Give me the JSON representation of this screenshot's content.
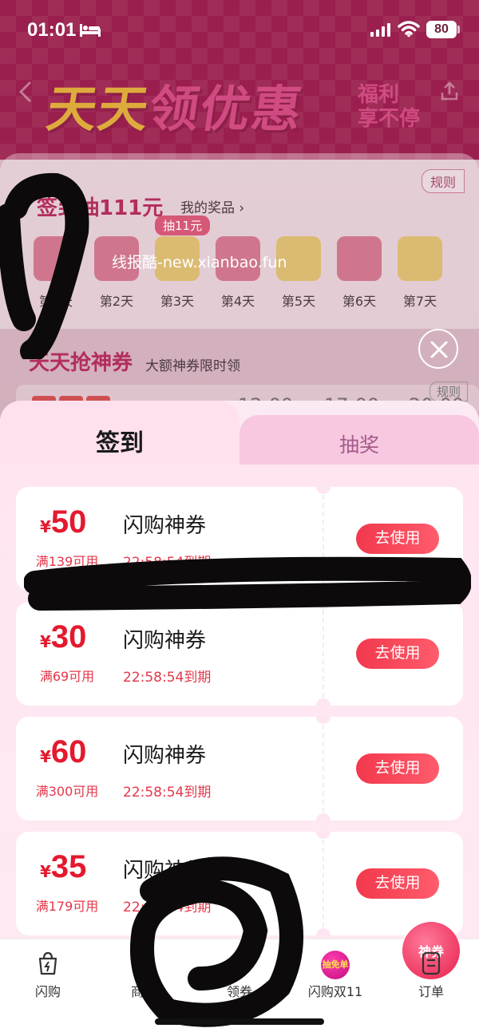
{
  "status_bar": {
    "time": "01:01",
    "battery": "80"
  },
  "banner": {
    "title_part1": "天天",
    "title_part2": "领优惠",
    "sub_line1": "福利",
    "sub_line2": "享不停"
  },
  "signin_section": {
    "rules": "规则",
    "title": "签到抽111元",
    "my_prizes": "我的奖品 ›",
    "lottery_bubble": "抽11元",
    "days": [
      "第1天",
      "第2天",
      "第3天",
      "第4天",
      "第5天",
      "第6天",
      "第7天"
    ]
  },
  "grab_section": {
    "title": "天天抢神券",
    "subtitle": "大额神券限时领",
    "rules": "规则",
    "slots": [
      "12:00",
      "17:00",
      "20:00"
    ]
  },
  "watermark": "线报酷-new.xianbao.fun",
  "modal": {
    "tabs": {
      "active": "签到",
      "inactive": "抽奖"
    },
    "coupons": [
      {
        "currency": "¥",
        "amount": "50",
        "condition": "满139可用",
        "name": "闪购神券",
        "expiry": "22:58:54到期",
        "action": "去使用"
      },
      {
        "currency": "¥",
        "amount": "30",
        "condition": "满69可用",
        "name": "闪购神券",
        "expiry": "22:58:54到期",
        "action": "去使用"
      },
      {
        "currency": "¥",
        "amount": "60",
        "condition": "满300可用",
        "name": "闪购神券",
        "expiry": "22:58:54到期",
        "action": "去使用"
      },
      {
        "currency": "¥",
        "amount": "35",
        "condition": "满179可用",
        "name": "闪购神券",
        "expiry": "22:58:54到期",
        "action": "去使用"
      }
    ]
  },
  "bottom_nav": {
    "items": [
      {
        "label": "闪购",
        "icon": "flash-bag-icon"
      },
      {
        "label": "商家",
        "icon": "store-icon"
      },
      {
        "label": "领券",
        "icon": "coupon-icon",
        "badge": "神券"
      },
      {
        "label": "闪购双11",
        "icon": "free-order-icon",
        "badge": "抽免单"
      },
      {
        "label": "订单",
        "icon": "order-icon"
      }
    ]
  },
  "colors": {
    "accent": "#e4192e",
    "button_gradient_start": "#f2384c",
    "tab_text_inactive": "#a55a8a"
  }
}
